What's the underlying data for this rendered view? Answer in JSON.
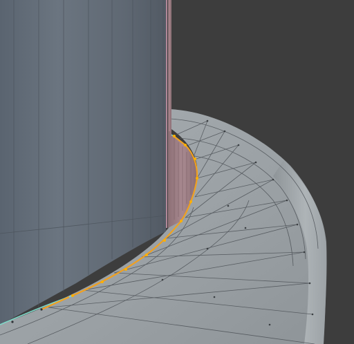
{
  "viewport": {
    "background_color": "#3d3d3d",
    "mode": "edit-mode",
    "view": "3d-viewport"
  },
  "mesh": {
    "cylinder_color": "#606a76",
    "base_color": "#9aa1a6",
    "gap_color": "#9a7c82",
    "wire_color": "#4f5358",
    "selected_edge_color": "#f0a020",
    "selected_vertex_color": "#ffb000",
    "seam_edge_color": "#7fd8c8",
    "highlight_edge_color": "#e59ad0"
  }
}
